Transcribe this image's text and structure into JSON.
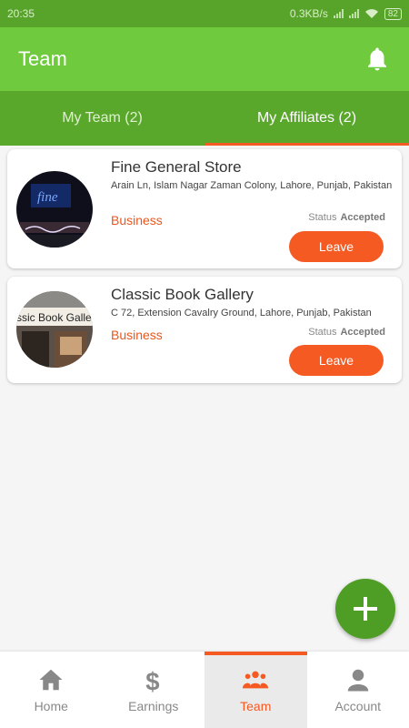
{
  "status_bar": {
    "time": "20:35",
    "net_speed": "0.3KB/s",
    "battery": "82"
  },
  "app_bar": {
    "title": "Team",
    "icon": "bell-icon"
  },
  "tabs": [
    {
      "label": "My Team (2)",
      "active": false
    },
    {
      "label": "My Affiliates (2)",
      "active": true
    }
  ],
  "affiliates": [
    {
      "name": "Fine General Store",
      "address": "Arain Ln, Islam Nagar Zaman Colony, Lahore, Punjab, Pakistan",
      "type": "Business",
      "status_label": "Status",
      "status_value": "Accepted",
      "action_label": "Leave",
      "image_text": "fine"
    },
    {
      "name": "Classic Book Gallery",
      "address": "C 72, Extension Cavalry Ground, Lahore, Punjab, Pakistan",
      "type": "Business",
      "status_label": "Status",
      "status_value": "Accepted",
      "action_label": "Leave",
      "image_text": "ssic Book Galle"
    }
  ],
  "fab": {
    "icon": "plus-icon"
  },
  "bottom_nav": [
    {
      "label": "Home",
      "icon": "home-icon",
      "active": false
    },
    {
      "label": "Earnings",
      "icon": "dollar-icon",
      "active": false
    },
    {
      "label": "Team",
      "icon": "team-icon",
      "active": true
    },
    {
      "label": "Account",
      "icon": "person-icon",
      "active": false
    }
  ],
  "colors": {
    "primary_green": "#6fcb3d",
    "dark_green": "#5aa82b",
    "accent_orange": "#f45a22"
  }
}
